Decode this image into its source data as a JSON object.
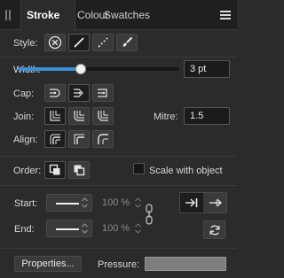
{
  "tabs": [
    {
      "label": "Stroke",
      "active": true
    },
    {
      "label": "Colour",
      "active": false
    },
    {
      "label": "Swatches",
      "active": false
    }
  ],
  "style": {
    "label": "Style:",
    "options": [
      "none-icon",
      "solid-line-icon",
      "dashed-line-icon",
      "brush-icon"
    ],
    "selected": "solid-line-icon"
  },
  "width": {
    "label": "Width:",
    "value": "3 pt",
    "slider_fraction": 0.39
  },
  "cap": {
    "label": "Cap:",
    "options": [
      "butt-cap-icon",
      "round-cap-icon",
      "square-cap-icon"
    ],
    "selected": "round-cap-icon"
  },
  "join": {
    "label": "Join:",
    "options": [
      "miter-join-icon",
      "round-join-icon",
      "bevel-join-icon"
    ],
    "selected": "miter-join-icon"
  },
  "mitre": {
    "label": "Mitre:",
    "value": "1.5"
  },
  "align": {
    "label": "Align:",
    "options": [
      "align-center-icon",
      "align-inside-icon",
      "align-outside-icon"
    ],
    "selected": "align-center-icon"
  },
  "order": {
    "label": "Order:",
    "options": [
      "stroke-behind-fill-icon",
      "stroke-in-front-icon"
    ],
    "selected": "stroke-behind-fill-icon"
  },
  "scale_with_object": {
    "label": "Scale with object",
    "checked": false
  },
  "start": {
    "label": "Start:",
    "scale": "100 %"
  },
  "end": {
    "label": "End:",
    "scale": "100 %"
  },
  "arrow_position": {
    "options": [
      "arrow-at-end-icon",
      "arrow-beyond-end-icon"
    ],
    "selected": "arrow-at-end-icon"
  },
  "properties_button": "Properties...",
  "pressure": {
    "label": "Pressure:"
  },
  "colors": {
    "accent": "#3d8fd6",
    "panel": "#2b2b2b",
    "tabbar": "#1f1f1f",
    "button": "#3a3a3a",
    "selected_button": "#1d1d1d"
  }
}
